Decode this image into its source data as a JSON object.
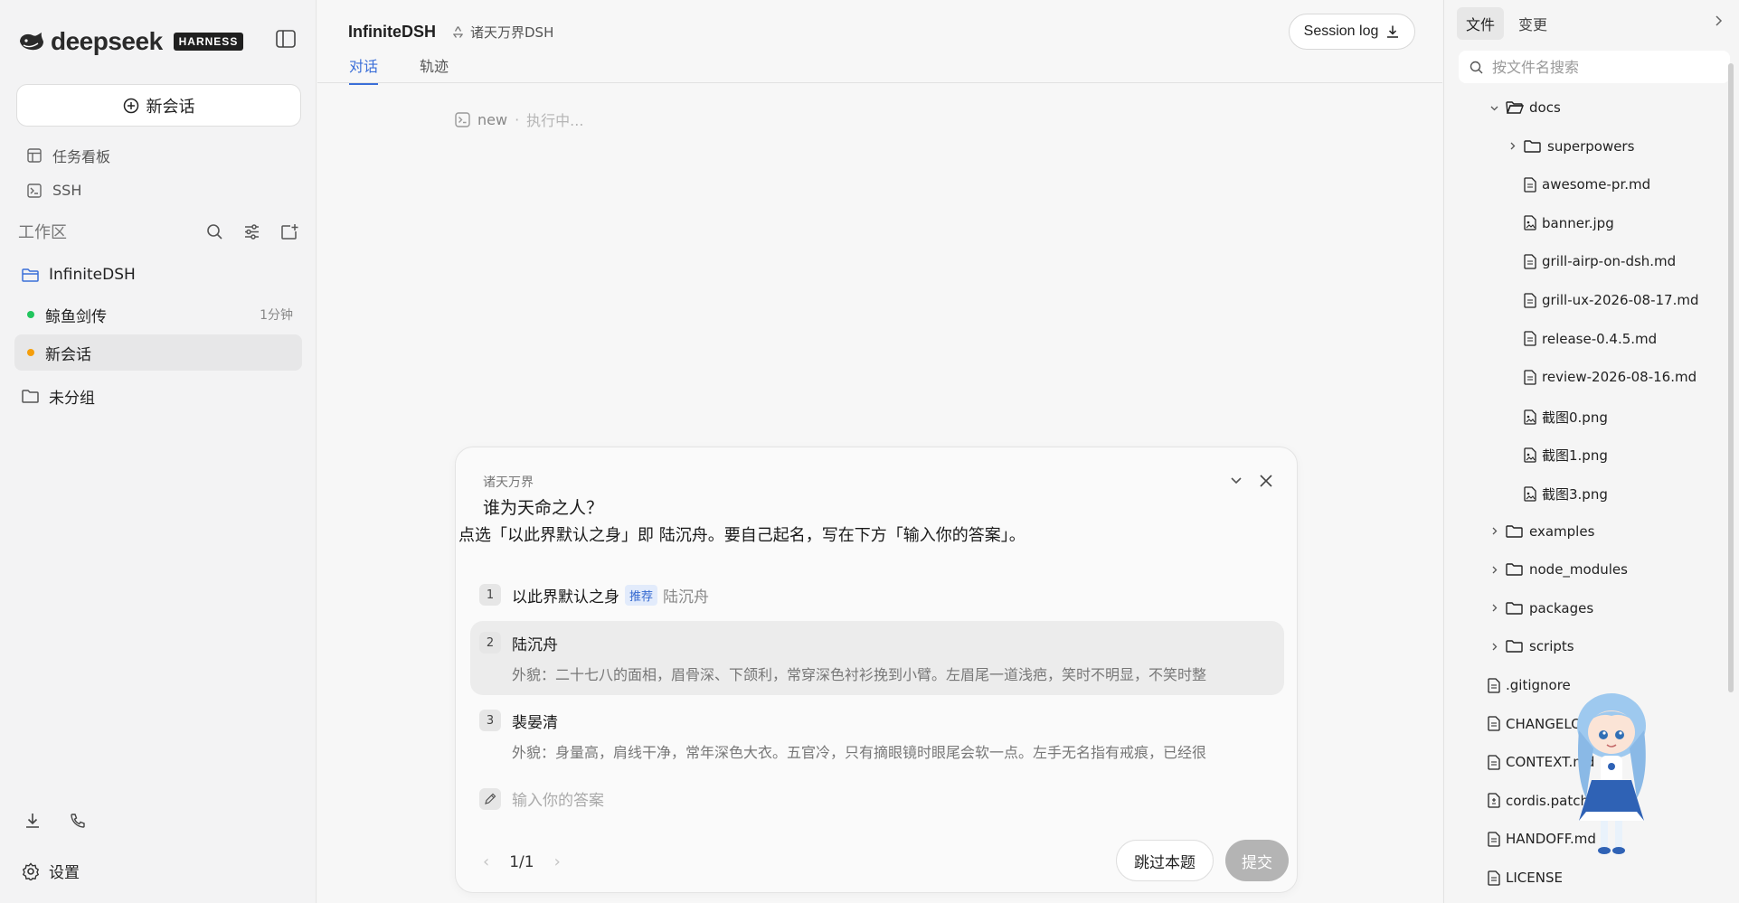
{
  "sidebar": {
    "brand": "deepseek",
    "badge": "HARNESS",
    "new_chat": "新会话",
    "nav": [
      {
        "label": "任务看板",
        "icon": "board-icon"
      },
      {
        "label": "SSH",
        "icon": "terminal-icon"
      }
    ],
    "workspace_label": "工作区",
    "project": "InfiniteDSH",
    "sessions": [
      {
        "label": "鲸鱼剑传",
        "time": "1分钟",
        "status_color": "#22c55e"
      },
      {
        "label": "新会话",
        "time": "",
        "status_color": "#f59e0b"
      }
    ],
    "ungrouped": "未分组",
    "settings": "设置"
  },
  "main": {
    "project_title": "InfiniteDSH",
    "project_subtitle": "诸天万界DSH",
    "session_log": "Session log",
    "tabs": [
      {
        "label": "对话",
        "active": true
      },
      {
        "label": "轨迹",
        "active": false
      }
    ],
    "exec": {
      "name": "new",
      "sep": "·",
      "status": "执行中..."
    }
  },
  "question": {
    "group": "诸天万界",
    "title": "谁为天命之人？",
    "description": "点选「以此界默认之身」即 陆沉舟。要自己起名，写在下方「输入你的答案」。",
    "options": [
      {
        "num": "1",
        "name": "以此界默认之身",
        "tag": "推荐",
        "hint": "陆沉舟",
        "detail": ""
      },
      {
        "num": "2",
        "name": "陆沉舟",
        "tag": "",
        "hint": "",
        "detail": "外貌：二十七八的面相，眉骨深、下颌利，常穿深色衬衫挽到小臂。左眉尾一道浅疤，笑时不明显，不笑时整"
      },
      {
        "num": "3",
        "name": "裴晏清",
        "tag": "",
        "hint": "",
        "detail": "外貌：身量高，肩线干净，常年深色大衣。五官冷，只有摘眼镜时眼尾会软一点。左手无名指有戒痕，已经很"
      }
    ],
    "answer_placeholder": "输入你的答案",
    "pager": "1/1",
    "skip": "跳过本题",
    "submit": "提交"
  },
  "files": {
    "tabs": [
      "文件",
      "变更"
    ],
    "search_placeholder": "按文件名搜索",
    "tree": [
      {
        "name": "docs",
        "type": "folder-open"
      },
      {
        "name": "superpowers",
        "type": "folder"
      },
      {
        "name": "awesome-pr.md",
        "type": "file"
      },
      {
        "name": "banner.jpg",
        "type": "image"
      },
      {
        "name": "grill-airp-on-dsh.md",
        "type": "file"
      },
      {
        "name": "grill-ux-2026-08-17.md",
        "type": "file"
      },
      {
        "name": "release-0.4.5.md",
        "type": "file"
      },
      {
        "name": "review-2026-08-16.md",
        "type": "file"
      },
      {
        "name": "截图0.png",
        "type": "image"
      },
      {
        "name": "截图1.png",
        "type": "image"
      },
      {
        "name": "截图3.png",
        "type": "image"
      },
      {
        "name": "examples",
        "type": "folder"
      },
      {
        "name": "node_modules",
        "type": "folder"
      },
      {
        "name": "packages",
        "type": "folder"
      },
      {
        "name": "scripts",
        "type": "folder"
      },
      {
        "name": ".gitignore",
        "type": "file"
      },
      {
        "name": "CHANGELOG.md",
        "type": "file"
      },
      {
        "name": "CONTEXT.md",
        "type": "file"
      },
      {
        "name": "cordis.patch",
        "type": "diff"
      },
      {
        "name": "HANDOFF.md",
        "type": "file"
      },
      {
        "name": "LICENSE",
        "type": "file"
      }
    ]
  },
  "colors": {
    "accent": "#3b6fd8",
    "active_dot": "#22c55e",
    "pending_dot": "#f59e0b"
  }
}
